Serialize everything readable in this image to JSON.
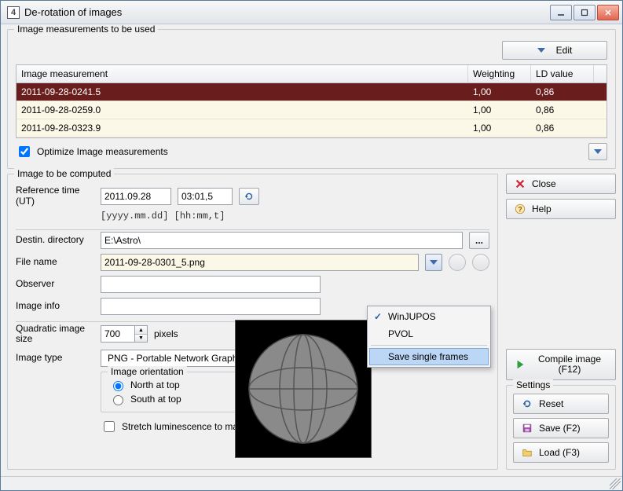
{
  "window": {
    "title": "De-rotation of images"
  },
  "measurements_group": {
    "title": "Image measurements to be used",
    "edit_label": "Edit",
    "columns": {
      "im": "Image measurement",
      "w": "Weighting",
      "ld": "LD value"
    },
    "rows": [
      {
        "im": "2011-09-28-0241.5",
        "w": "1,00",
        "ld": "0,86",
        "selected": true
      },
      {
        "im": "2011-09-28-0259.0",
        "w": "1,00",
        "ld": "0,86",
        "selected": false
      },
      {
        "im": "2011-09-28-0323.9",
        "w": "1,00",
        "ld": "0,86",
        "selected": false
      }
    ],
    "optimize_label": "Optimize Image measurements",
    "optimize_checked": true
  },
  "compute_group": {
    "title": "Image to be computed",
    "ref_time_label": "Reference time (UT)",
    "ref_date": "2011.09.28",
    "ref_time": "03:01,5",
    "ref_hint": "[yyyy.mm.dd] [hh:mm,t]",
    "dest_label": "Destin. directory",
    "dest_value": "E:\\Astro\\",
    "browse_label": "...",
    "file_label": "File name",
    "file_value": "2011-09-28-0301_5.png",
    "observer_label": "Observer",
    "observer_value": "",
    "info_label": "Image info",
    "info_value": "",
    "quad_label": "Quadratic image size",
    "quad_value": "700",
    "quad_unit": "pixels",
    "type_label": "Image type",
    "type_value": "PNG  - Portable Network Graphics (48 bit)",
    "orient_title": "Image orientation",
    "orient_north": "North at top",
    "orient_south": "South at top",
    "orient_value": "north",
    "stretch_label": "Stretch luminescence to maximum dynamic range",
    "stretch_checked": false
  },
  "dropdown": {
    "item1": "WinJUPOS",
    "item2": "PVOL",
    "item3": "Save single frames",
    "checked": "WinJUPOS",
    "hover": "Save single frames"
  },
  "side": {
    "close": "Close",
    "help": "Help",
    "compile": "Compile image (F12)",
    "settings_title": "Settings",
    "reset": "Reset",
    "save": "Save (F2)",
    "load": "Load (F3)"
  }
}
